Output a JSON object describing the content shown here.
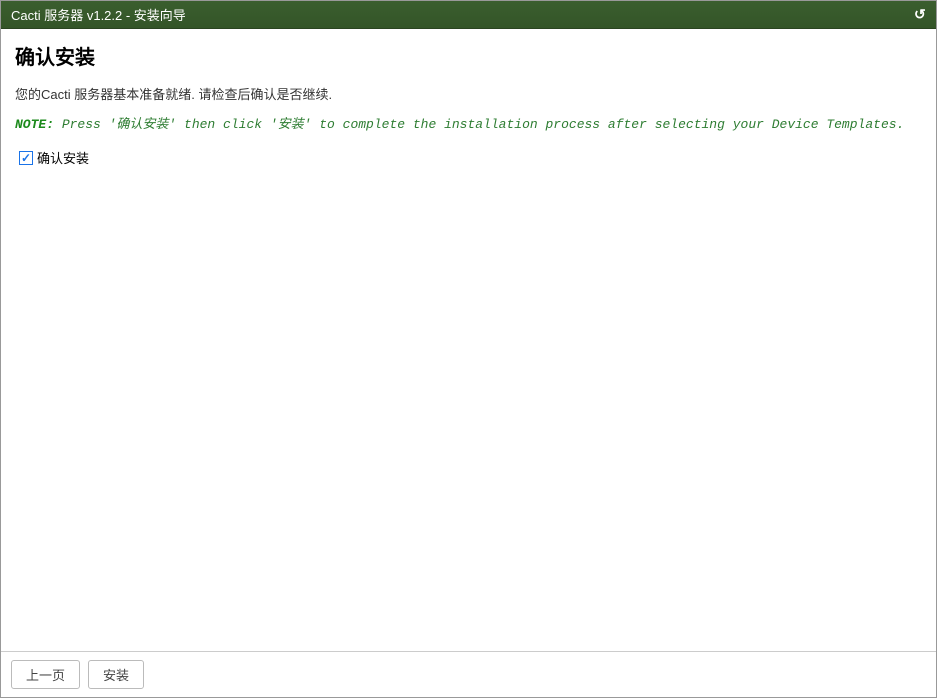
{
  "header": {
    "title": "Cacti 服务器 v1.2.2 - 安装向导"
  },
  "content": {
    "heading": "确认安装",
    "intro": "您的Cacti 服务器基本准备就绪. 请检查后确认是否继续.",
    "note_label": "NOTE:",
    "note_text": " Press '确认安装' then click '安装' to complete the installation process after selecting your Device Templates.",
    "checkbox": {
      "label": "确认安装",
      "checked": true
    }
  },
  "footer": {
    "previous_label": "上一页",
    "install_label": "安装"
  }
}
